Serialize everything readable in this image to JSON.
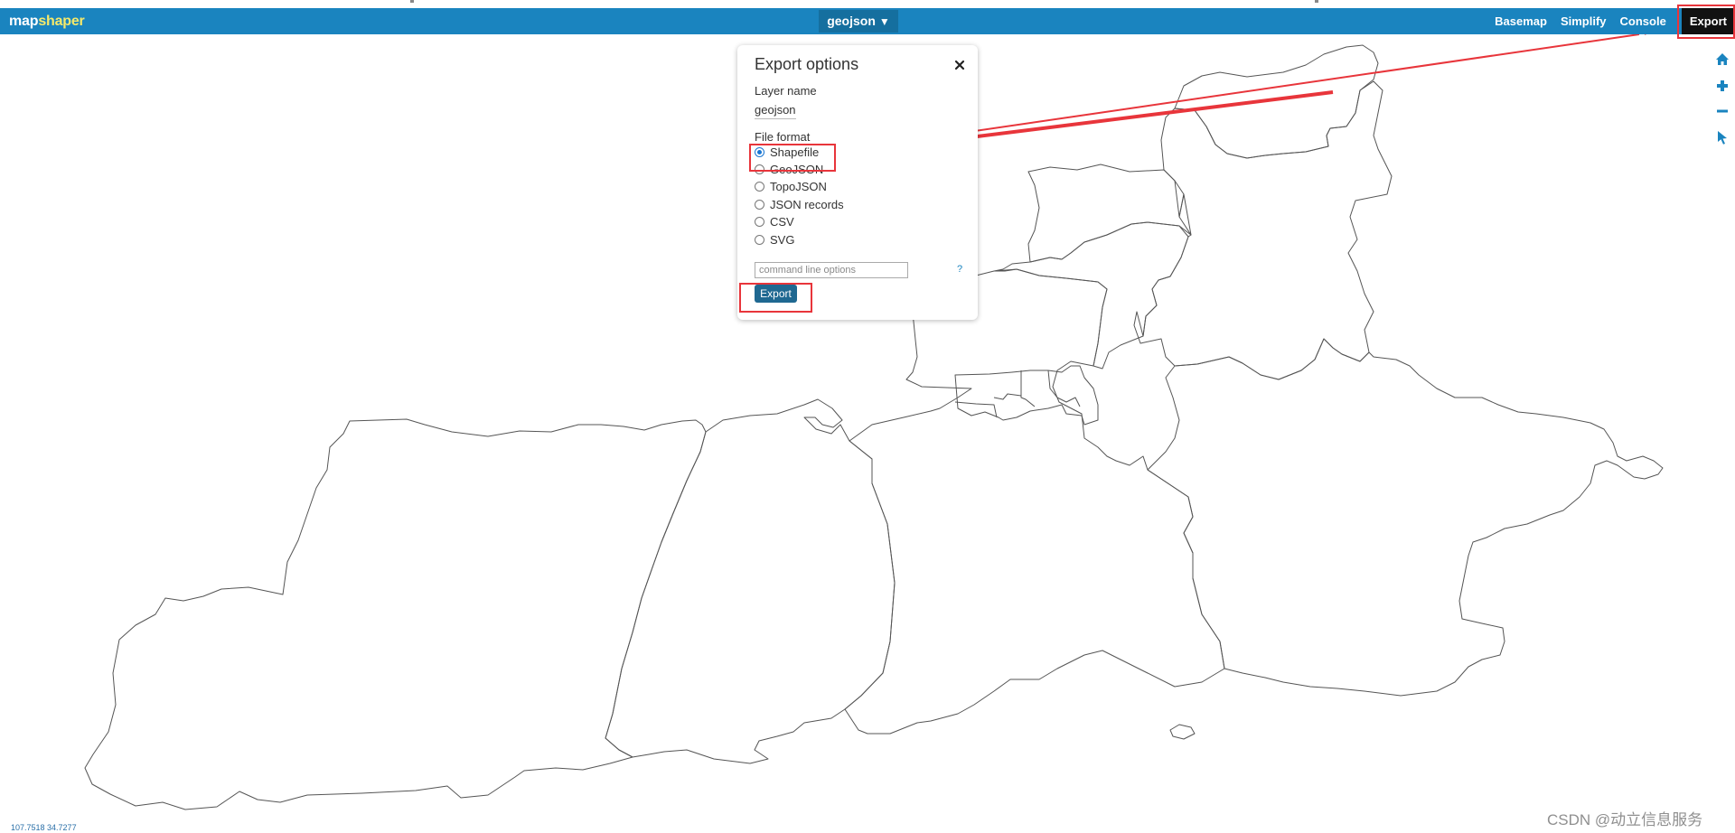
{
  "app": {
    "logo_main": "map",
    "logo_accent": "shaper",
    "layer_button_label": "geojson",
    "layer_button_caret": "▼"
  },
  "nav": {
    "items": [
      "Basemap",
      "Simplify",
      "Console"
    ],
    "export_label": "Export"
  },
  "tools": [
    "home-icon",
    "zoom-in-icon",
    "zoom-out-icon",
    "pointer-icon"
  ],
  "dialog": {
    "title": "Export options",
    "close_glyph": "✕",
    "layer_name_label": "Layer name",
    "layer_name_value": "geojson",
    "file_format_label": "File format",
    "formats": [
      "Shapefile",
      "GeoJSON",
      "TopoJSON",
      "JSON records",
      "CSV",
      "SVG"
    ],
    "selected_format": "Shapefile",
    "cmd_placeholder": "command line options",
    "help_label": "?",
    "export_button_label": "Export"
  },
  "status": {
    "coordinates": "107.7518 34.7277"
  },
  "watermark": "CSDN @动立信息服务",
  "colors": {
    "header": "#1a84bf",
    "layer_button": "#156f9f",
    "logo_accent": "#f6e96a",
    "nav_export_bg": "#111111",
    "dialog_button": "#1f6891",
    "annotation": "#e8353b",
    "map_outline": "#555555"
  }
}
